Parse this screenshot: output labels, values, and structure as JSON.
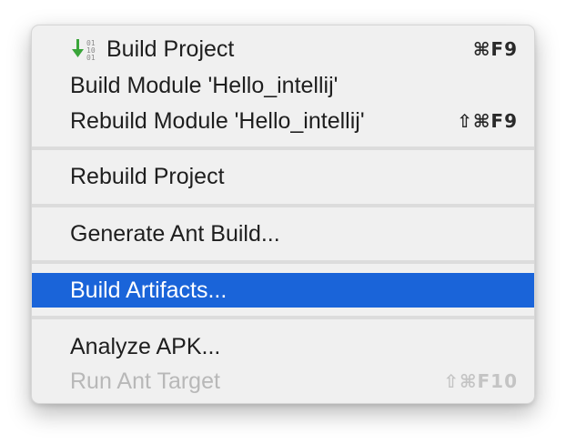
{
  "menu": {
    "items": [
      {
        "label": "Build Project",
        "shortcut": "⌘F9",
        "icon": "build-project-icon"
      },
      {
        "label": "Build Module 'Hello_intellij'",
        "shortcut": ""
      },
      {
        "label": "Rebuild Module 'Hello_intellij'",
        "shortcut": "⇧⌘F9"
      },
      {
        "label": "Rebuild Project",
        "shortcut": ""
      },
      {
        "label": "Generate Ant Build...",
        "shortcut": ""
      },
      {
        "label": "Build Artifacts...",
        "shortcut": "",
        "state": "selected"
      },
      {
        "label": "Analyze APK...",
        "shortcut": ""
      },
      {
        "label": "Run Ant Target",
        "shortcut": "⇧⌘F10",
        "state": "disabled"
      }
    ],
    "colors": {
      "selection": "#1a64d9",
      "background": "#f0f0f0",
      "disabled_text": "#b8b8b8",
      "icon_arrow": "#3aa53a"
    }
  }
}
